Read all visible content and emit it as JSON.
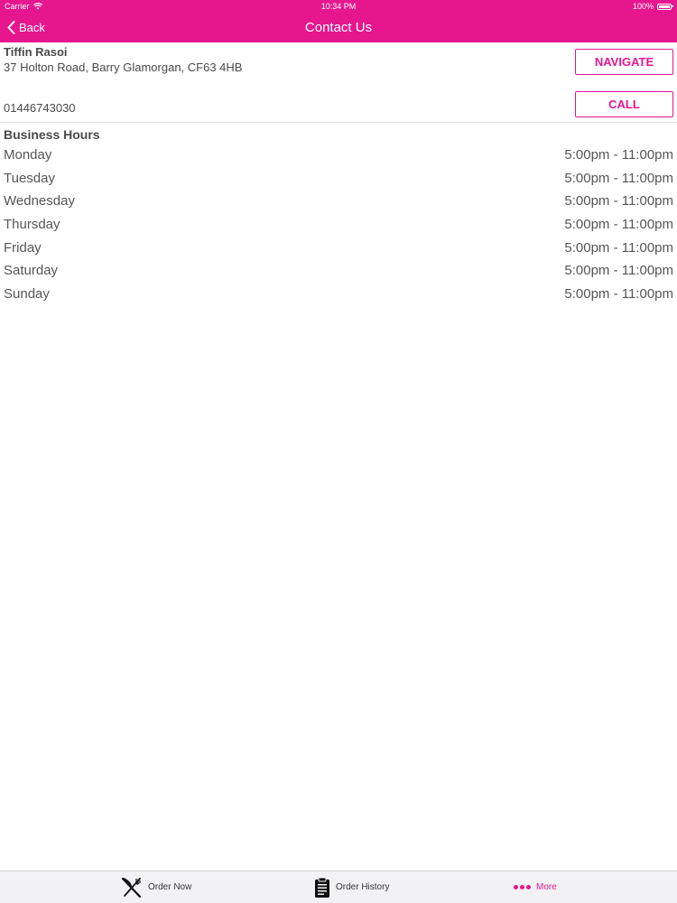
{
  "status_bar": {
    "carrier": "Carrier",
    "time": "10:34 PM",
    "battery": "100%"
  },
  "nav": {
    "back_label": "Back",
    "title": "Contact Us"
  },
  "contact": {
    "name": "Tiffin Rasoi",
    "address": "37 Holton Road, Barry Glamorgan, CF63 4HB",
    "phone": "01446743030",
    "navigate_label": "NAVIGATE",
    "call_label": "CALL"
  },
  "hours": {
    "title": "Business Hours",
    "days": [
      {
        "day": "Monday",
        "time": "5:00pm - 11:00pm"
      },
      {
        "day": "Tuesday",
        "time": "5:00pm - 11:00pm"
      },
      {
        "day": "Wednesday",
        "time": "5:00pm - 11:00pm"
      },
      {
        "day": "Thursday",
        "time": "5:00pm - 11:00pm"
      },
      {
        "day": "Friday",
        "time": "5:00pm - 11:00pm"
      },
      {
        "day": "Saturday",
        "time": "5:00pm - 11:00pm"
      },
      {
        "day": "Sunday",
        "time": "5:00pm - 11:00pm"
      }
    ]
  },
  "tab_bar": {
    "order_now": "Order Now",
    "order_history": "Order History",
    "more": "More"
  },
  "colors": {
    "brand": "#e6168f",
    "text": "#4a4a4a",
    "tab_background": "#f2f2f4"
  },
  "icons": {
    "status": [
      "wifi-icon",
      "battery-icon"
    ],
    "nav": [
      "chevron-left-icon"
    ],
    "tabs": [
      "fork-knife-icon",
      "clipboard-icon",
      "more-dots-icon"
    ]
  }
}
